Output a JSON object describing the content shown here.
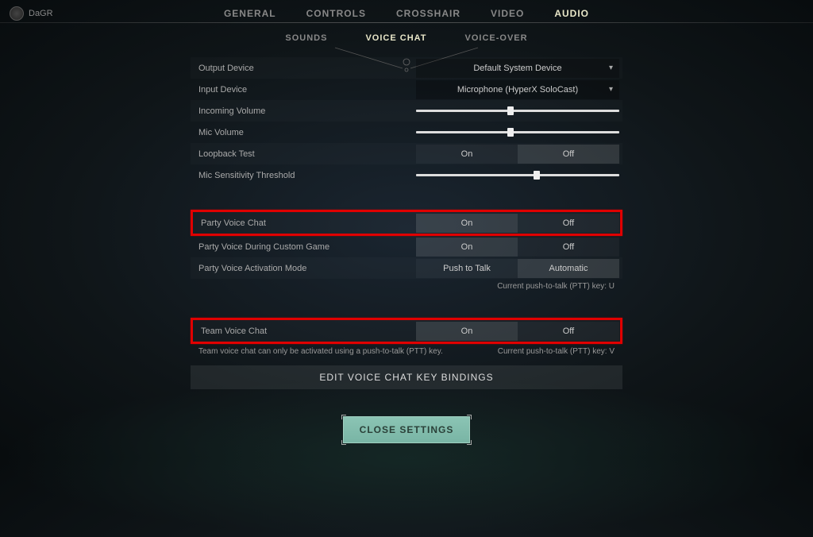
{
  "player": {
    "name": "DaGR"
  },
  "tabs_main": [
    {
      "label": "GENERAL",
      "active": false
    },
    {
      "label": "CONTROLS",
      "active": false
    },
    {
      "label": "CROSSHAIR",
      "active": false
    },
    {
      "label": "VIDEO",
      "active": false
    },
    {
      "label": "AUDIO",
      "active": true
    }
  ],
  "tabs_sub": [
    {
      "label": "SOUNDS",
      "active": false
    },
    {
      "label": "VOICE CHAT",
      "active": true
    },
    {
      "label": "VOICE-OVER",
      "active": false
    }
  ],
  "settings": {
    "output_device": {
      "label": "Output Device",
      "value": "Default System Device"
    },
    "input_device": {
      "label": "Input Device",
      "value": "Microphone (HyperX SoloCast)"
    },
    "incoming_volume": {
      "label": "Incoming Volume",
      "percent": 45
    },
    "mic_volume": {
      "label": "Mic Volume",
      "percent": 45
    },
    "loopback": {
      "label": "Loopback Test",
      "on": "On",
      "off": "Off",
      "selected": "Off"
    },
    "mic_threshold": {
      "label": "Mic Sensitivity Threshold",
      "percent": 58
    },
    "party_voice": {
      "label": "Party Voice Chat",
      "on": "On",
      "off": "Off",
      "selected": "On"
    },
    "party_custom": {
      "label": "Party Voice During Custom Game",
      "on": "On",
      "off": "Off",
      "selected": "On"
    },
    "party_mode": {
      "label": "Party Voice Activation Mode",
      "opt1": "Push to Talk",
      "opt2": "Automatic",
      "selected": "Automatic"
    },
    "ptt_party": "Current push-to-talk (PTT) key: U",
    "team_voice": {
      "label": "Team Voice Chat",
      "on": "On",
      "off": "Off",
      "selected": "On"
    },
    "team_note": "Team voice chat can only be activated using a push-to-talk (PTT) key.",
    "ptt_team": "Current push-to-talk (PTT) key: V",
    "edit_bindings": "EDIT VOICE CHAT KEY BINDINGS"
  },
  "close_label": "CLOSE SETTINGS"
}
